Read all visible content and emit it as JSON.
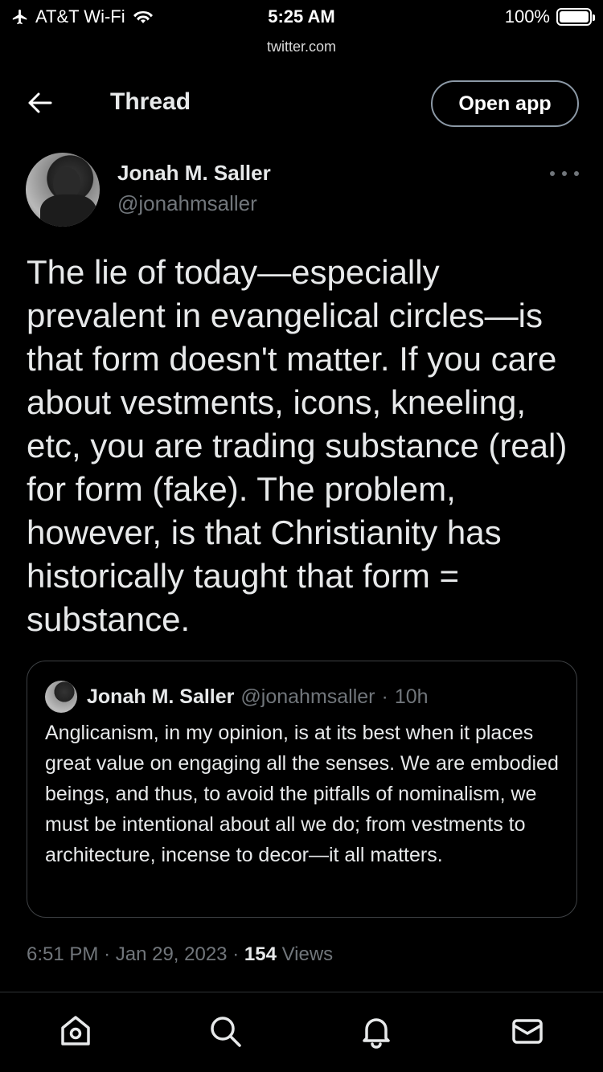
{
  "status_bar": {
    "carrier": "AT&T Wi-Fi",
    "time": "5:25 AM",
    "battery": "100%",
    "battery_level": 1.0,
    "url": "twitter.com"
  },
  "header": {
    "title": "Thread",
    "open_app_label": "Open app"
  },
  "tweet": {
    "author_name": "Jonah M. Saller",
    "author_handle": "@jonahmsaller",
    "text": "The lie of today—especially prevalent in evangelical circles—is that form doesn't matter. If you care about vestments, icons, kneeling, etc, you are trading substance (real) for form (fake). The problem, however, is that Christianity has historically taught that form = substance.",
    "time": "6:51 PM",
    "date": "Jan 29, 2023",
    "views_count": "154",
    "views_label": "Views"
  },
  "quote": {
    "author_name": "Jonah M. Saller",
    "author_handle": "@jonahmsaller",
    "age": "10h",
    "text": "Anglicanism, in my opinion, is at its best when it places great value on engaging all the senses. We are embodied beings, and thus, to avoid the pitfalls of nominalism, we must be intentional about all we do; from vestments to architecture, incense to decor—it all matters."
  },
  "nav": {
    "items": [
      "home-icon",
      "search-icon",
      "notifications-icon",
      "messages-icon"
    ]
  },
  "colors": {
    "background": "#000000",
    "text": "#e7e9ea",
    "secondary": "#71767b",
    "border": "#2f3336"
  }
}
